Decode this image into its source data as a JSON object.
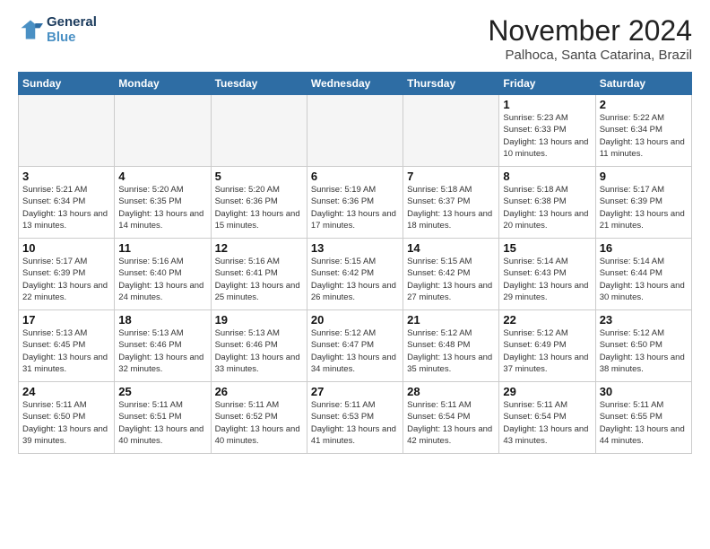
{
  "header": {
    "logo_line1": "General",
    "logo_line2": "Blue",
    "month_title": "November 2024",
    "location": "Palhoca, Santa Catarina, Brazil"
  },
  "weekdays": [
    "Sunday",
    "Monday",
    "Tuesday",
    "Wednesday",
    "Thursday",
    "Friday",
    "Saturday"
  ],
  "weeks": [
    [
      {
        "day": "",
        "info": ""
      },
      {
        "day": "",
        "info": ""
      },
      {
        "day": "",
        "info": ""
      },
      {
        "day": "",
        "info": ""
      },
      {
        "day": "",
        "info": ""
      },
      {
        "day": "1",
        "info": "Sunrise: 5:23 AM\nSunset: 6:33 PM\nDaylight: 13 hours and 10 minutes."
      },
      {
        "day": "2",
        "info": "Sunrise: 5:22 AM\nSunset: 6:34 PM\nDaylight: 13 hours and 11 minutes."
      }
    ],
    [
      {
        "day": "3",
        "info": "Sunrise: 5:21 AM\nSunset: 6:34 PM\nDaylight: 13 hours and 13 minutes."
      },
      {
        "day": "4",
        "info": "Sunrise: 5:20 AM\nSunset: 6:35 PM\nDaylight: 13 hours and 14 minutes."
      },
      {
        "day": "5",
        "info": "Sunrise: 5:20 AM\nSunset: 6:36 PM\nDaylight: 13 hours and 15 minutes."
      },
      {
        "day": "6",
        "info": "Sunrise: 5:19 AM\nSunset: 6:36 PM\nDaylight: 13 hours and 17 minutes."
      },
      {
        "day": "7",
        "info": "Sunrise: 5:18 AM\nSunset: 6:37 PM\nDaylight: 13 hours and 18 minutes."
      },
      {
        "day": "8",
        "info": "Sunrise: 5:18 AM\nSunset: 6:38 PM\nDaylight: 13 hours and 20 minutes."
      },
      {
        "day": "9",
        "info": "Sunrise: 5:17 AM\nSunset: 6:39 PM\nDaylight: 13 hours and 21 minutes."
      }
    ],
    [
      {
        "day": "10",
        "info": "Sunrise: 5:17 AM\nSunset: 6:39 PM\nDaylight: 13 hours and 22 minutes."
      },
      {
        "day": "11",
        "info": "Sunrise: 5:16 AM\nSunset: 6:40 PM\nDaylight: 13 hours and 24 minutes."
      },
      {
        "day": "12",
        "info": "Sunrise: 5:16 AM\nSunset: 6:41 PM\nDaylight: 13 hours and 25 minutes."
      },
      {
        "day": "13",
        "info": "Sunrise: 5:15 AM\nSunset: 6:42 PM\nDaylight: 13 hours and 26 minutes."
      },
      {
        "day": "14",
        "info": "Sunrise: 5:15 AM\nSunset: 6:42 PM\nDaylight: 13 hours and 27 minutes."
      },
      {
        "day": "15",
        "info": "Sunrise: 5:14 AM\nSunset: 6:43 PM\nDaylight: 13 hours and 29 minutes."
      },
      {
        "day": "16",
        "info": "Sunrise: 5:14 AM\nSunset: 6:44 PM\nDaylight: 13 hours and 30 minutes."
      }
    ],
    [
      {
        "day": "17",
        "info": "Sunrise: 5:13 AM\nSunset: 6:45 PM\nDaylight: 13 hours and 31 minutes."
      },
      {
        "day": "18",
        "info": "Sunrise: 5:13 AM\nSunset: 6:46 PM\nDaylight: 13 hours and 32 minutes."
      },
      {
        "day": "19",
        "info": "Sunrise: 5:13 AM\nSunset: 6:46 PM\nDaylight: 13 hours and 33 minutes."
      },
      {
        "day": "20",
        "info": "Sunrise: 5:12 AM\nSunset: 6:47 PM\nDaylight: 13 hours and 34 minutes."
      },
      {
        "day": "21",
        "info": "Sunrise: 5:12 AM\nSunset: 6:48 PM\nDaylight: 13 hours and 35 minutes."
      },
      {
        "day": "22",
        "info": "Sunrise: 5:12 AM\nSunset: 6:49 PM\nDaylight: 13 hours and 37 minutes."
      },
      {
        "day": "23",
        "info": "Sunrise: 5:12 AM\nSunset: 6:50 PM\nDaylight: 13 hours and 38 minutes."
      }
    ],
    [
      {
        "day": "24",
        "info": "Sunrise: 5:11 AM\nSunset: 6:50 PM\nDaylight: 13 hours and 39 minutes."
      },
      {
        "day": "25",
        "info": "Sunrise: 5:11 AM\nSunset: 6:51 PM\nDaylight: 13 hours and 40 minutes."
      },
      {
        "day": "26",
        "info": "Sunrise: 5:11 AM\nSunset: 6:52 PM\nDaylight: 13 hours and 40 minutes."
      },
      {
        "day": "27",
        "info": "Sunrise: 5:11 AM\nSunset: 6:53 PM\nDaylight: 13 hours and 41 minutes."
      },
      {
        "day": "28",
        "info": "Sunrise: 5:11 AM\nSunset: 6:54 PM\nDaylight: 13 hours and 42 minutes."
      },
      {
        "day": "29",
        "info": "Sunrise: 5:11 AM\nSunset: 6:54 PM\nDaylight: 13 hours and 43 minutes."
      },
      {
        "day": "30",
        "info": "Sunrise: 5:11 AM\nSunset: 6:55 PM\nDaylight: 13 hours and 44 minutes."
      }
    ]
  ]
}
